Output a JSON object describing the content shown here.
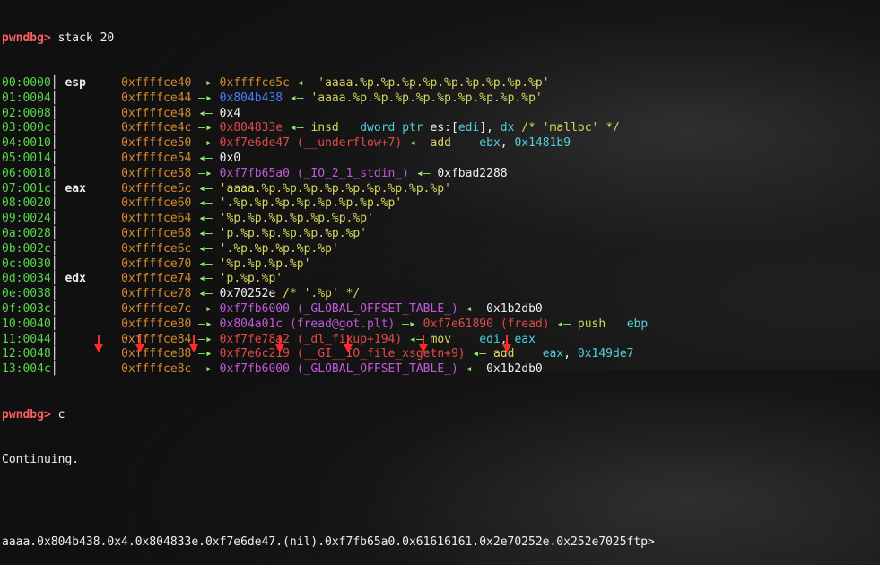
{
  "prompt": "pwndbg>",
  "command1": " stack 20",
  "rows": [
    {
      "idx": "00:0000",
      "reg": "esp",
      "addr": "0xffffce40",
      "arrow": " —▸ ",
      "val": "0xffffce5c",
      "valc": "orange",
      "rest": [
        {
          "t": " ◂— ",
          "c": "bgreen"
        },
        {
          "t": "'aaaa.%p.%p.%p.%p.%p.%p.%p.%p.%p'",
          "c": "yellow"
        }
      ]
    },
    {
      "idx": "01:0004",
      "reg": "",
      "addr": "0xffffce44",
      "arrow": " —▸ ",
      "val": "0x804b438",
      "valc": "blue",
      "rest": [
        {
          "t": " ◂— ",
          "c": "bgreen"
        },
        {
          "t": "'aaaa.%p.%p.%p.%p.%p.%p.%p.%p.%p'",
          "c": "yellow"
        }
      ]
    },
    {
      "idx": "02:0008",
      "reg": "",
      "addr": "0xffffce48",
      "arrow": " ◂— ",
      "val": "0x4",
      "valc": "white",
      "rest": []
    },
    {
      "idx": "03:000c",
      "reg": "",
      "addr": "0xffffce4c",
      "arrow": " —▸ ",
      "val": "0x804833e",
      "valc": "red",
      "rest": [
        {
          "t": " ◂— ",
          "c": "bgreen"
        },
        {
          "t": "insd   ",
          "c": "yellow"
        },
        {
          "t": "dword ptr ",
          "c": "cyan"
        },
        {
          "t": "es:",
          "c": "white"
        },
        {
          "t": "[",
          "c": "white"
        },
        {
          "t": "edi",
          "c": "cyan"
        },
        {
          "t": "], ",
          "c": "white"
        },
        {
          "t": "dx",
          "c": "cyan"
        },
        {
          "t": " /* 'malloc' */",
          "c": "yellow"
        }
      ]
    },
    {
      "idx": "04:0010",
      "reg": "",
      "addr": "0xffffce50",
      "arrow": " —▸ ",
      "val": "0xf7e6de47",
      "valc": "red",
      "rest": [
        {
          "t": " (__underflow+7)",
          "c": "red"
        },
        {
          "t": " ◂— ",
          "c": "bgreen"
        },
        {
          "t": "add    ",
          "c": "yellow"
        },
        {
          "t": "ebx",
          "c": "cyan"
        },
        {
          "t": ", ",
          "c": "white"
        },
        {
          "t": "0x1481b9",
          "c": "cyan"
        }
      ]
    },
    {
      "idx": "05:0014",
      "reg": "",
      "addr": "0xffffce54",
      "arrow": " ◂— ",
      "val": "0x0",
      "valc": "white",
      "rest": []
    },
    {
      "idx": "06:0018",
      "reg": "",
      "addr": "0xffffce58",
      "arrow": " —▸ ",
      "val": "0xf7fb65a0",
      "valc": "purple",
      "rest": [
        {
          "t": " (_IO_2_1_stdin_)",
          "c": "purple"
        },
        {
          "t": " ◂— ",
          "c": "bgreen"
        },
        {
          "t": "0xfbad2288",
          "c": "white"
        }
      ]
    },
    {
      "idx": "07:001c",
      "reg": "eax",
      "addr": "0xffffce5c",
      "arrow": " ◂— ",
      "val": "'aaaa.%p.%p.%p.%p.%p.%p.%p.%p.%p'",
      "valc": "yellow",
      "rest": []
    },
    {
      "idx": "08:0020",
      "reg": "",
      "addr": "0xffffce60",
      "arrow": " ◂— ",
      "val": "'.%p.%p.%p.%p.%p.%p.%p.%p'",
      "valc": "yellow",
      "rest": []
    },
    {
      "idx": "09:0024",
      "reg": "",
      "addr": "0xffffce64",
      "arrow": " ◂— ",
      "val": "'%p.%p.%p.%p.%p.%p.%p'",
      "valc": "yellow",
      "rest": []
    },
    {
      "idx": "0a:0028",
      "reg": "",
      "addr": "0xffffce68",
      "arrow": " ◂— ",
      "val": "'p.%p.%p.%p.%p.%p.%p'",
      "valc": "yellow",
      "rest": []
    },
    {
      "idx": "0b:002c",
      "reg": "",
      "addr": "0xffffce6c",
      "arrow": " ◂— ",
      "val": "'.%p.%p.%p.%p.%p'",
      "valc": "yellow",
      "rest": []
    },
    {
      "idx": "0c:0030",
      "reg": "",
      "addr": "0xffffce70",
      "arrow": " ◂— ",
      "val": "'%p.%p.%p.%p'",
      "valc": "yellow",
      "rest": []
    },
    {
      "idx": "0d:0034",
      "reg": "edx",
      "addr": "0xffffce74",
      "arrow": " ◂— ",
      "val": "'p.%p.%p'",
      "valc": "yellow",
      "rest": []
    },
    {
      "idx": "0e:0038",
      "reg": "",
      "addr": "0xffffce78",
      "arrow": " ◂— ",
      "val": "0x70252e",
      "valc": "white",
      "rest": [
        {
          "t": " /* '.%p' */",
          "c": "yellow"
        }
      ]
    },
    {
      "idx": "0f:003c",
      "reg": "",
      "addr": "0xffffce7c",
      "arrow": " —▸ ",
      "val": "0xf7fb6000",
      "valc": "purple",
      "rest": [
        {
          "t": " (_GLOBAL_OFFSET_TABLE_)",
          "c": "purple"
        },
        {
          "t": " ◂— ",
          "c": "bgreen"
        },
        {
          "t": "0x1b2db0",
          "c": "white"
        }
      ]
    },
    {
      "idx": "10:0040",
      "reg": "",
      "addr": "0xffffce80",
      "arrow": " —▸ ",
      "val": "0x804a01c",
      "valc": "purple",
      "rest": [
        {
          "t": " (fread@got.plt)",
          "c": "purple"
        },
        {
          "t": " —▸ ",
          "c": "bgreen"
        },
        {
          "t": "0xf7e61890",
          "c": "red"
        },
        {
          "t": " (fread)",
          "c": "red"
        },
        {
          "t": " ◂— ",
          "c": "bgreen"
        },
        {
          "t": "push   ",
          "c": "yellow"
        },
        {
          "t": "ebp",
          "c": "cyan"
        }
      ]
    },
    {
      "idx": "11:0044",
      "reg": "",
      "addr": "0xffffce84",
      "arrow": " —▸ ",
      "val": "0xf7fe78a2",
      "valc": "red",
      "rest": [
        {
          "t": " (_dl_fixup+194)",
          "c": "red"
        },
        {
          "t": " ◂— ",
          "c": "bgreen"
        },
        {
          "t": "mov    ",
          "c": "yellow"
        },
        {
          "t": "edi",
          "c": "cyan"
        },
        {
          "t": ", ",
          "c": "white"
        },
        {
          "t": "eax",
          "c": "cyan"
        }
      ]
    },
    {
      "idx": "12:0048",
      "reg": "",
      "addr": "0xffffce88",
      "arrow": " —▸ ",
      "val": "0xf7e6c219",
      "valc": "red",
      "rest": [
        {
          "t": " (__GI__IO_file_xsgetn+9)",
          "c": "red"
        },
        {
          "t": " ◂— ",
          "c": "bgreen"
        },
        {
          "t": "add    ",
          "c": "yellow"
        },
        {
          "t": "eax",
          "c": "cyan"
        },
        {
          "t": ", ",
          "c": "white"
        },
        {
          "t": "0x149de7",
          "c": "cyan"
        }
      ]
    },
    {
      "idx": "13:004c",
      "reg": "",
      "addr": "0xffffce8c",
      "arrow": " —▸ ",
      "val": "0xf7fb6000",
      "valc": "purple",
      "rest": [
        {
          "t": " (_GLOBAL_OFFSET_TABLE_)",
          "c": "purple"
        },
        {
          "t": " ◂— ",
          "c": "bgreen"
        },
        {
          "t": "0x1b2db0",
          "c": "white"
        }
      ]
    }
  ],
  "command2": " c",
  "continuing": "Continuing.",
  "output": "aaaa.0x804b438.0x4.0x804833e.0xf7e6de47.(nil).0xf7fb65a0.0x61616161.0x2e70252e.0x252e7025ftp>",
  "colors": {
    "prompt": "#ff5f5f",
    "index": "#58d84a",
    "address": "#d6892e",
    "marker_arrow": "#ff2a2a",
    "background": "#101010"
  },
  "markers": 7
}
